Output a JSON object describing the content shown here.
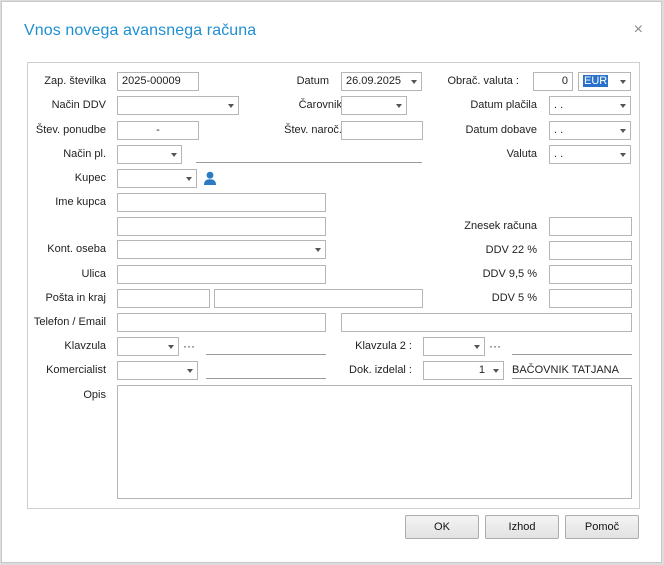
{
  "dialog": {
    "title": "Vnos novega avansnega računa",
    "close_label": "×"
  },
  "labels": {
    "zap_stevilka": "Zap. številka",
    "nacin_ddv": "Način DDV",
    "stev_ponudbe": "Štev. ponudbe",
    "nacin_pl": "Način pl.",
    "kupec": "Kupec",
    "ime_kupca": "Ime kupca",
    "kont_oseba": "Kont. oseba",
    "ulica": "Ulica",
    "posta_in_kraj": "Pošta in kraj",
    "telefon_email": "Telefon / Email",
    "klavzula": "Klavzula",
    "komercialist": "Komercialist",
    "opis": "Opis",
    "datum": "Datum",
    "carovnik": "Čarovnik",
    "stev_naroc": "Štev. naroč.",
    "klavzula2": "Klavzula 2 :",
    "dok_izdelal": "Dok. izdelal :",
    "obrac_valuta": "Obrač. valuta :",
    "datum_placila": "Datum plačila",
    "datum_dobave": "Datum dobave",
    "valuta": "Valuta",
    "znesek_racuna": "Znesek računa",
    "ddv22": "DDV 22 %",
    "ddv95": "DDV 9,5 %",
    "ddv5": "DDV 5 %"
  },
  "values": {
    "zap_stevilka": "2025-00009",
    "stev_ponudbe": "-",
    "datum": "26.09.2025",
    "obrac_valuta_rate": "0",
    "obrac_valuta_currency": "EUR",
    "datum_placila": ". .",
    "datum_dobave": ". .",
    "valuta": ". .",
    "dok_izdelal": "1",
    "dok_izdelal_name": "BAČOVNIK TATJANA",
    "ellipsis": "···"
  },
  "buttons": {
    "ok": "OK",
    "izhod": "Izhod",
    "pomoc": "Pomoč"
  },
  "colors": {
    "title": "#1f8fd1",
    "selection": "#2a71c9",
    "user_icon": "#2b7bc2"
  }
}
